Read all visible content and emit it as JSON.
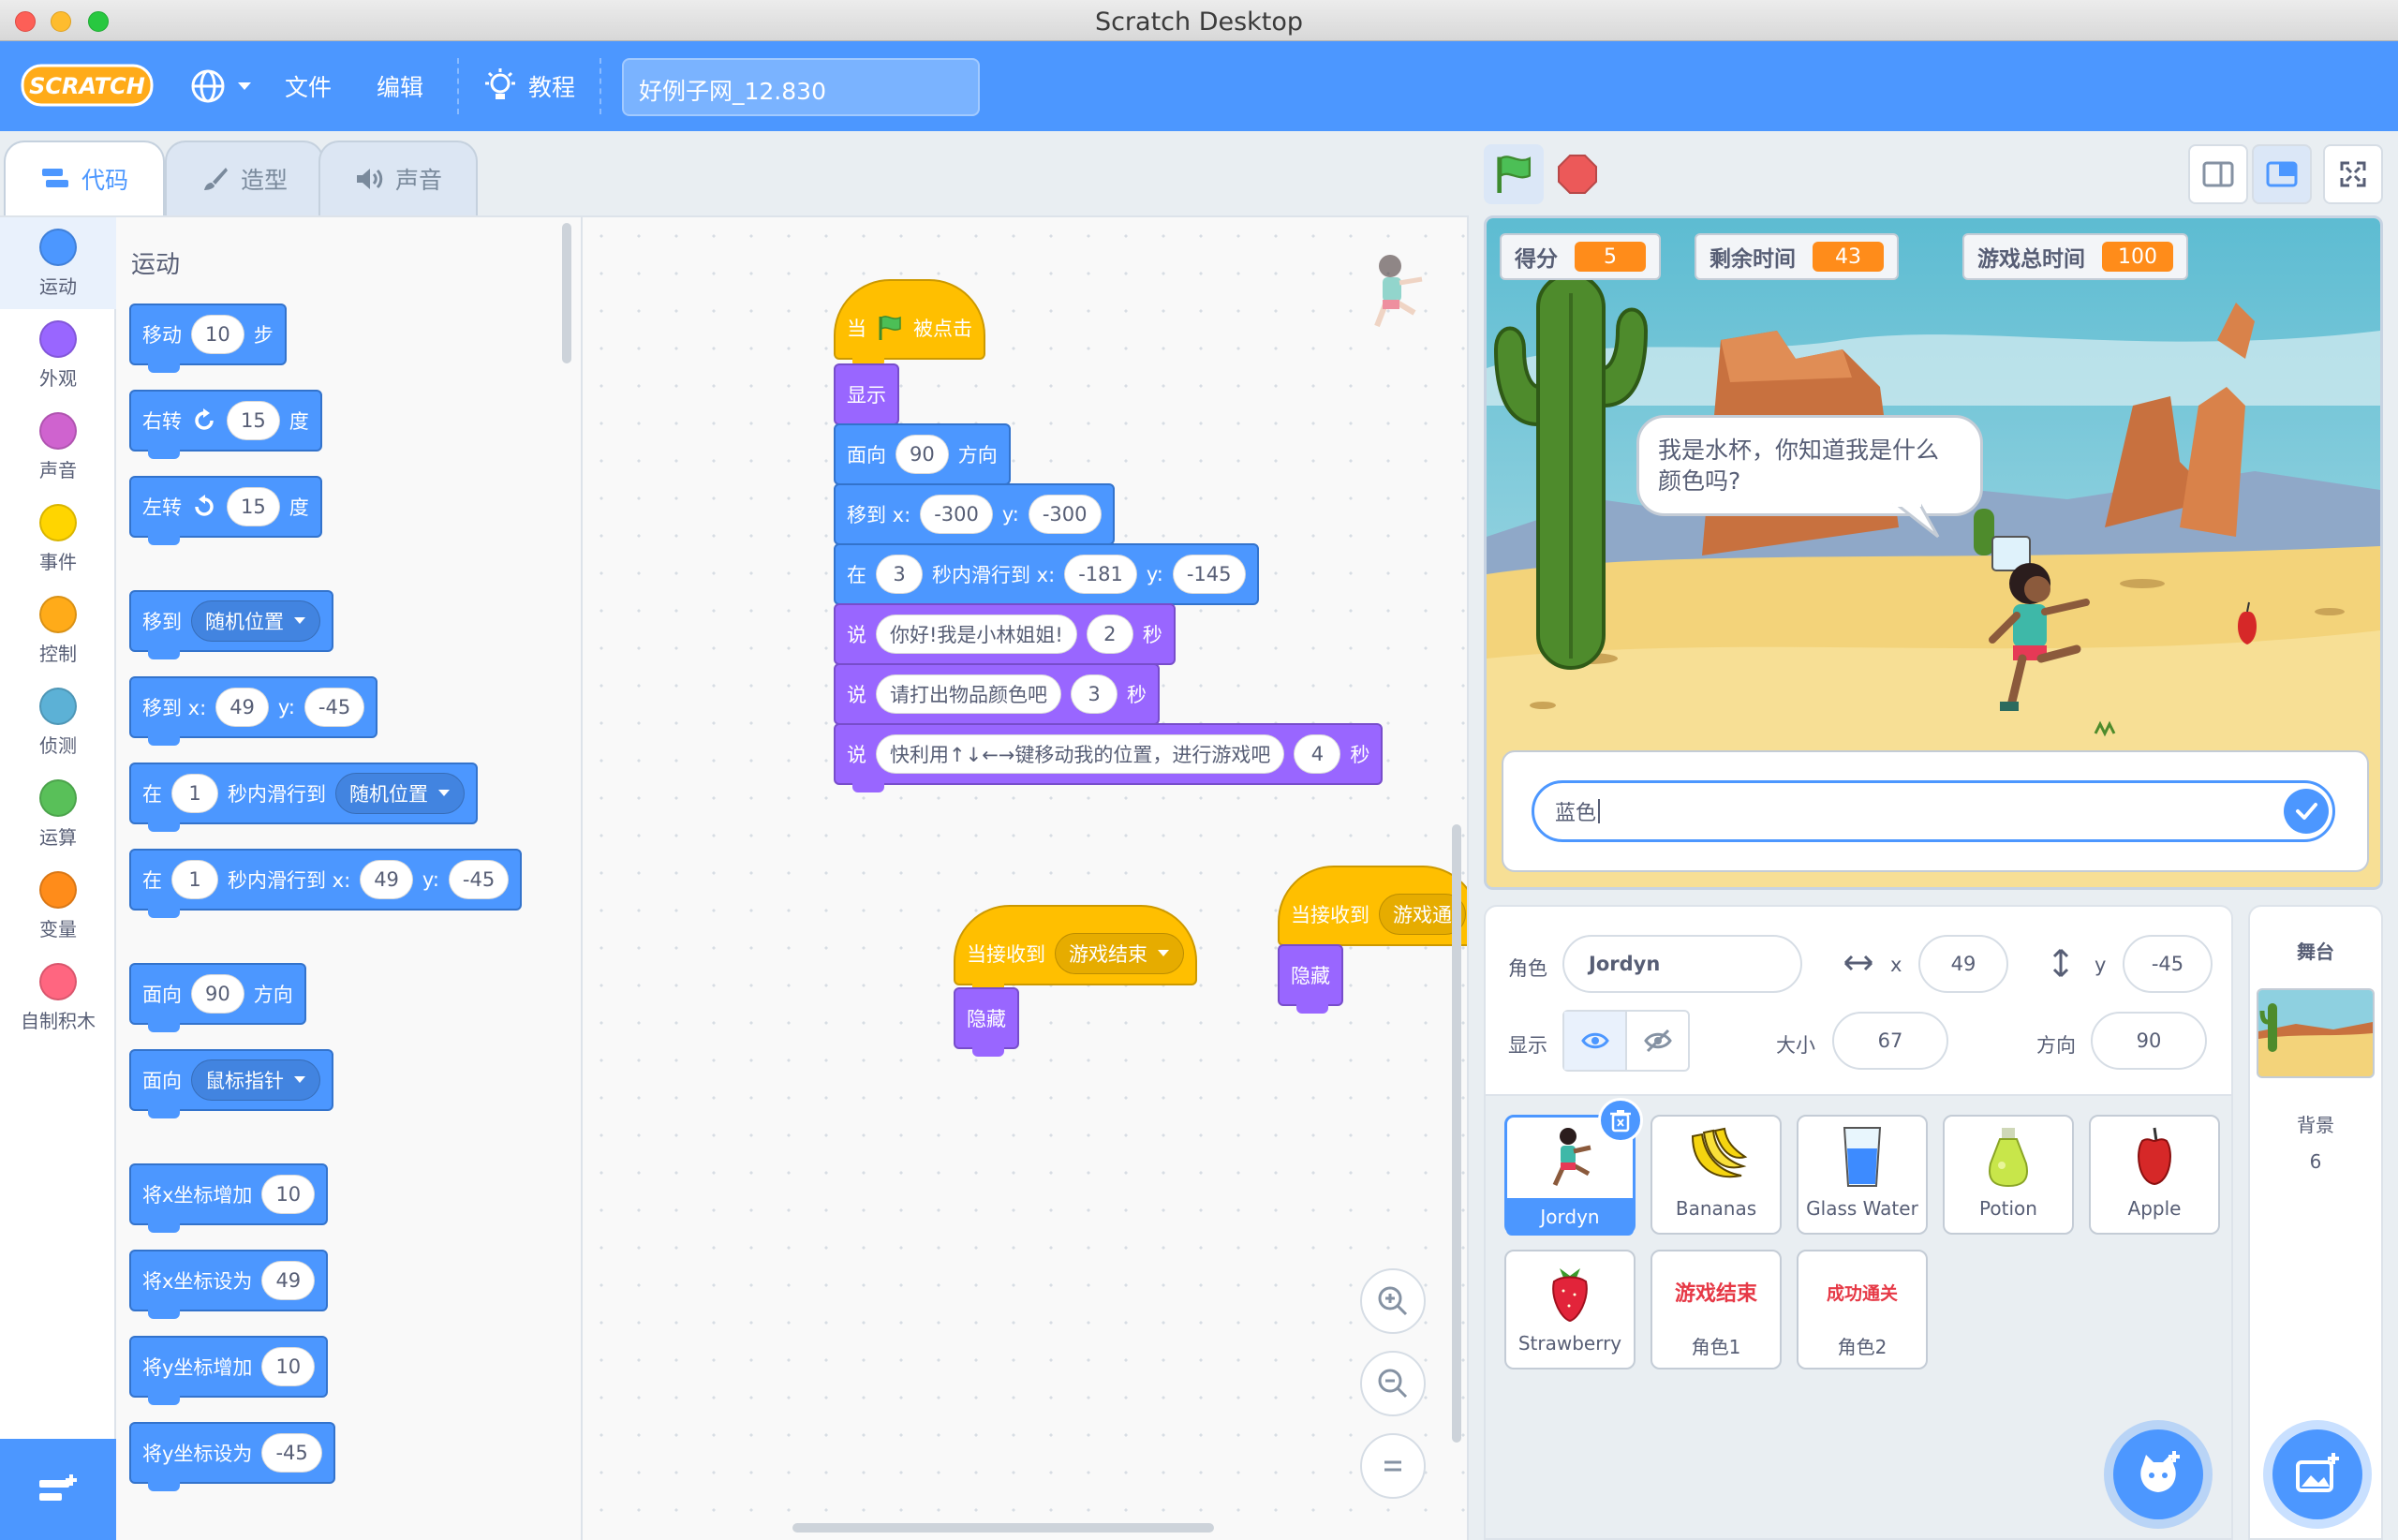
{
  "window": {
    "title": "Scratch Desktop"
  },
  "menubar": {
    "file": "文件",
    "edit": "编辑",
    "tutorials": "教程",
    "project_title": "好例子网_12.830"
  },
  "tabs": {
    "code": "代码",
    "costumes": "造型",
    "sounds": "声音"
  },
  "categories": [
    {
      "label": "运动",
      "color": "#4c97ff"
    },
    {
      "label": "外观",
      "color": "#9966ff"
    },
    {
      "label": "声音",
      "color": "#cf63cf"
    },
    {
      "label": "事件",
      "color": "#ffd500"
    },
    {
      "label": "控制",
      "color": "#ffab19"
    },
    {
      "label": "侦测",
      "color": "#5cb1d6"
    },
    {
      "label": "运算",
      "color": "#59c059"
    },
    {
      "label": "变量",
      "color": "#ff8c1a"
    },
    {
      "label": "自制积木",
      "color": "#ff6680"
    }
  ],
  "palette": {
    "heading": "运动",
    "b1": {
      "a": "移动",
      "v": "10",
      "b": "步"
    },
    "b2": {
      "a": "右转",
      "v": "15",
      "b": "度"
    },
    "b3": {
      "a": "左转",
      "v": "15",
      "b": "度"
    },
    "b4": {
      "a": "移到",
      "dd": "随机位置"
    },
    "b5": {
      "a": "移到 x:",
      "x": "49",
      "b": "y:",
      "y": "-45"
    },
    "b6": {
      "a": "在",
      "v": "1",
      "b": "秒内滑行到",
      "dd": "随机位置"
    },
    "b7": {
      "a": "在",
      "v": "1",
      "b": "秒内滑行到 x:",
      "x": "49",
      "c": "y:",
      "y": "-45"
    },
    "b8": {
      "a": "面向",
      "v": "90",
      "b": "方向"
    },
    "b9": {
      "a": "面向",
      "dd": "鼠标指针"
    },
    "b10": {
      "a": "将x坐标增加",
      "v": "10"
    },
    "b11": {
      "a": "将x坐标设为",
      "v": "49"
    },
    "b12": {
      "a": "将y坐标增加",
      "v": "10"
    },
    "b13": {
      "a": "将y坐标设为",
      "v": "-45"
    }
  },
  "script": {
    "hat": {
      "a": "当",
      "b": "被点击"
    },
    "show": "显示",
    "point": {
      "a": "面向",
      "v": "90",
      "b": "方向"
    },
    "goto": {
      "a": "移到 x:",
      "x": "-300",
      "b": "y:",
      "y": "-300"
    },
    "glide": {
      "a": "在",
      "v": "3",
      "b": "秒内滑行到 x:",
      "x": "-181",
      "c": "y:",
      "y": "-145"
    },
    "say1": {
      "a": "说",
      "msg": "你好!我是小林姐姐!",
      "v": "2",
      "b": "秒"
    },
    "say2": {
      "a": "说",
      "msg": "请打出物品颜色吧",
      "v": "3",
      "b": "秒"
    },
    "say3": {
      "a": "说",
      "msg": "快利用↑↓←→键移动我的位置，进行游戏吧",
      "v": "4",
      "b": "秒"
    }
  },
  "script2": {
    "a": "当接收到",
    "dd": "游戏结束",
    "hide": "隐藏"
  },
  "script3": {
    "a": "当接收到",
    "dd": "游戏通",
    "hide": "隐藏"
  },
  "monitors": [
    {
      "label": "得分",
      "value": "5"
    },
    {
      "label": "剩余时间",
      "value": "43"
    },
    {
      "label": "游戏总时间",
      "value": "100"
    }
  ],
  "stage": {
    "bubble": "我是水杯，你知道我是什么颜色吗?",
    "answer": "蓝色"
  },
  "sprite_info": {
    "sprite_label": "角色",
    "sprite_name": "Jordyn",
    "x_label": "x",
    "x": "49",
    "y_label": "y",
    "y": "-45",
    "show_label": "显示",
    "size_label": "大小",
    "size": "67",
    "direction_label": "方向",
    "direction": "90"
  },
  "sprites": [
    {
      "name": "Jordyn"
    },
    {
      "name": "Bananas"
    },
    {
      "name": "Glass Water"
    },
    {
      "name": "Potion"
    },
    {
      "name": "Apple"
    },
    {
      "name": "Strawberry"
    },
    {
      "name": "角色1",
      "thumb_text": "游戏结束"
    },
    {
      "name": "角色2",
      "thumb_text": "成功通关"
    }
  ],
  "stage_pane": {
    "title": "舞台",
    "backdrops_label": "背景",
    "backdrops_count": "6"
  }
}
